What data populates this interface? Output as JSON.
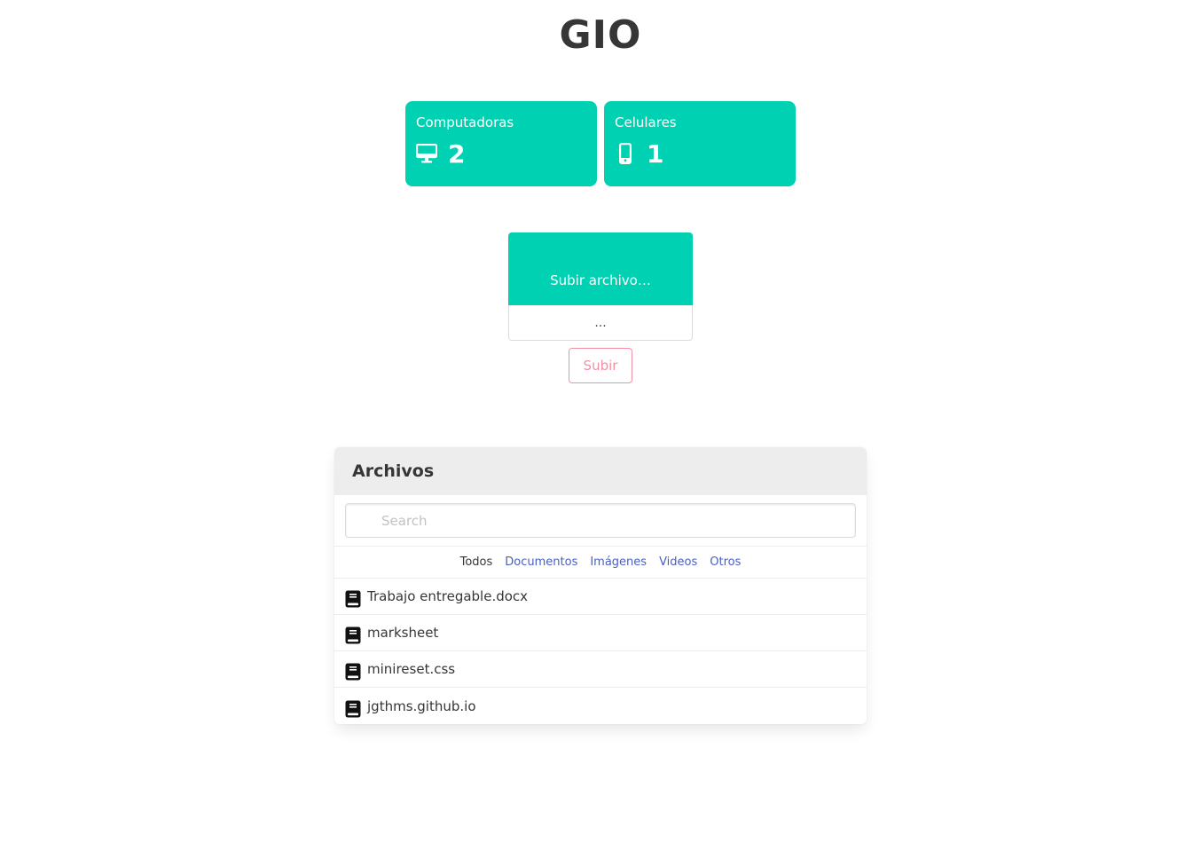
{
  "header": {
    "title": "GIO"
  },
  "stats": [
    {
      "label": "Computadoras",
      "value": "2",
      "icon": "desktop-icon"
    },
    {
      "label": "Celulares",
      "value": "1",
      "icon": "mobile-phone-icon"
    }
  ],
  "colors": {
    "primary": "#00d1b2",
    "danger": "#f14668",
    "link": "#485fc7"
  },
  "upload": {
    "cta_label": "Subir archivo…",
    "file_name": "...",
    "submit_label": "Subir"
  },
  "files_panel": {
    "heading": "Archivos",
    "search_placeholder": "Search",
    "tabs": [
      {
        "label": "Todos",
        "active": true
      },
      {
        "label": "Documentos",
        "active": false
      },
      {
        "label": "Imágenes",
        "active": false
      },
      {
        "label": "Videos",
        "active": false
      },
      {
        "label": "Otros",
        "active": false
      }
    ],
    "files": [
      {
        "name": "Trabajo entregable.docx",
        "icon": "book-icon"
      },
      {
        "name": "marksheet",
        "icon": "book-icon"
      },
      {
        "name": "minireset.css",
        "icon": "book-icon"
      },
      {
        "name": "jgthms.github.io",
        "icon": "book-icon"
      }
    ]
  }
}
